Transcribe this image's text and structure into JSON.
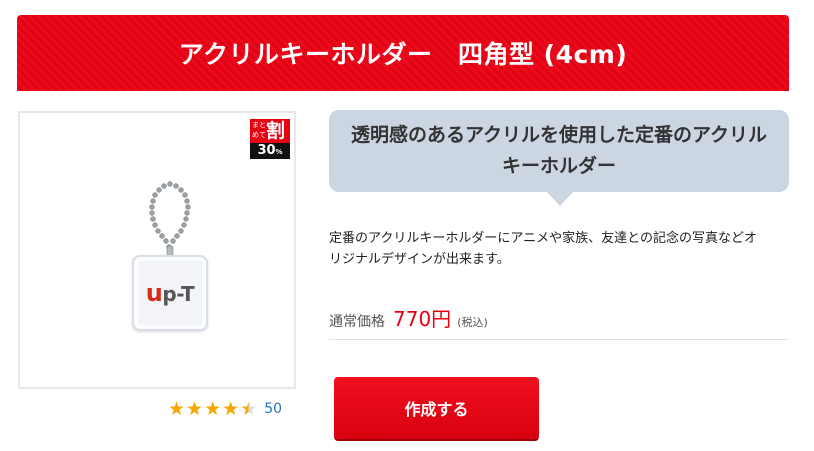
{
  "header": {
    "title": "アクリルキーホルダー　四角型 (4cm)"
  },
  "product": {
    "badge": {
      "matome": "まとめて",
      "wari": "割",
      "percent": "30",
      "percent_sign": "%"
    },
    "logo": {
      "u": "u",
      "rest": "p-T"
    },
    "rating": {
      "value": 4.5,
      "max": 5,
      "count": "50"
    }
  },
  "bubble": {
    "line1": "透明感のあるアクリルを使用した定番のアクリル",
    "line2": "キーホルダー"
  },
  "description": {
    "line1": "定番のアクリルキーホルダーにアニメや家族、友達との記念の写真などオ",
    "line2": "リジナルデザインが出来ます。"
  },
  "price": {
    "label": "通常価格",
    "amount": "770円",
    "tax": "(税込)"
  },
  "cta": {
    "label": "作成する"
  },
  "colors": {
    "brand_red": "#e60012",
    "bubble_bg": "#ccd6e3",
    "star": "#f5a800",
    "link_blue": "#2a73c2"
  }
}
